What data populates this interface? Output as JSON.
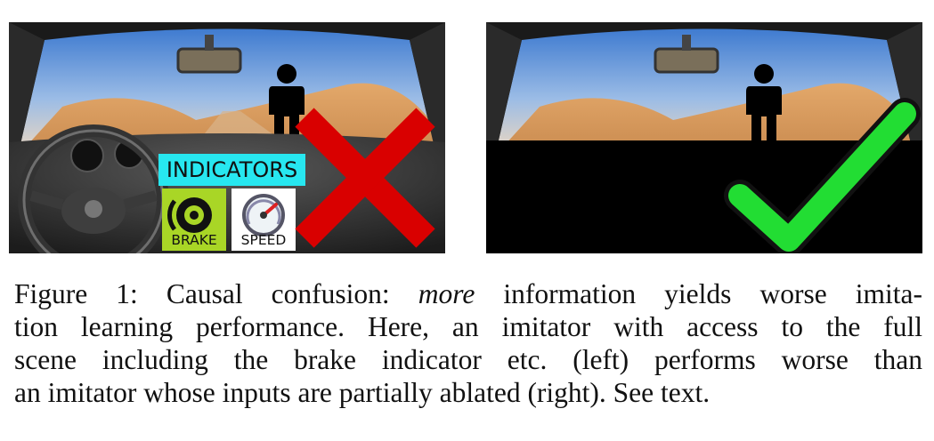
{
  "figure": {
    "left_panel": {
      "indicators_label": "INDICATORS",
      "brake_label": "BRAKE",
      "speed_label": "SPEED",
      "mark": "cross",
      "mark_color": "#d90000"
    },
    "right_panel": {
      "mark": "check",
      "mark_color": "#22dd33",
      "ablated_region_color": "#000000"
    },
    "colors": {
      "indicators_bg": "#27e7f0",
      "brake_bg": "#a9d626",
      "sky": "#5a8fd6",
      "desert": "#d99a5a"
    }
  },
  "caption": {
    "label": "Figure 1:",
    "lead": " Causal confusion: ",
    "emphasis": "more",
    "line1_rest": " information yields worse imita-",
    "line2": "tion learning performance. Here, an imitator with access to the full",
    "line3": "scene including the brake indicator etc. (left) performs worse than",
    "line4": "an imitator whose inputs are partially ablated (right). See text."
  }
}
